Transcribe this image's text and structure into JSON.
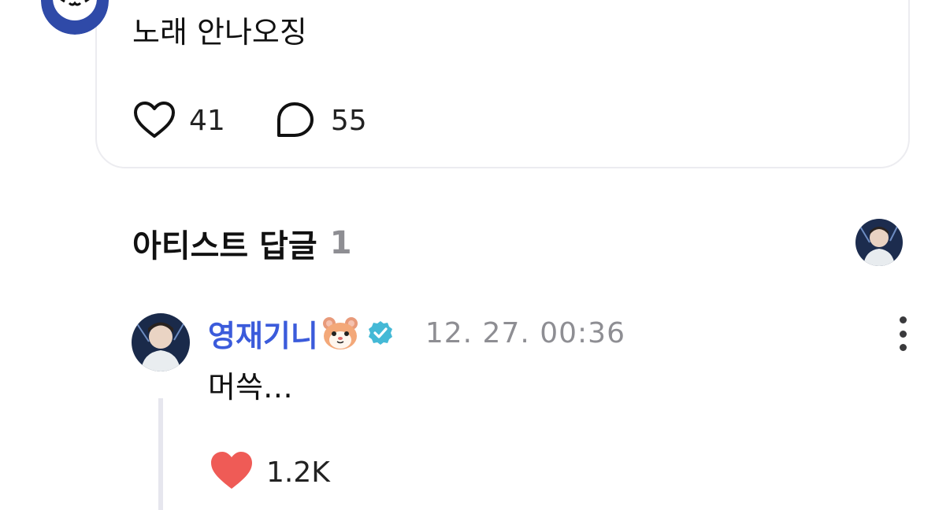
{
  "post": {
    "text": "노래 안나오징",
    "likes": "41",
    "comments": "55",
    "avatar_icon": "panda-avatar-icon"
  },
  "artist_replies": {
    "title": "아티스트 답글",
    "count": "1",
    "avatar_icon": "artist-avatar-icon"
  },
  "reply": {
    "author": "영재기니",
    "emoji_icon": "hamster-face-emoji",
    "verified_icon": "verified-badge-icon",
    "timestamp": "12. 27. 00:36",
    "text": "머쓱…",
    "likes": "1.2K",
    "liked": true
  },
  "colors": {
    "author": "#3b5bdb",
    "verified": "#44b9d6",
    "liked_heart": "#ef5b56",
    "muted": "#8e8e93"
  }
}
